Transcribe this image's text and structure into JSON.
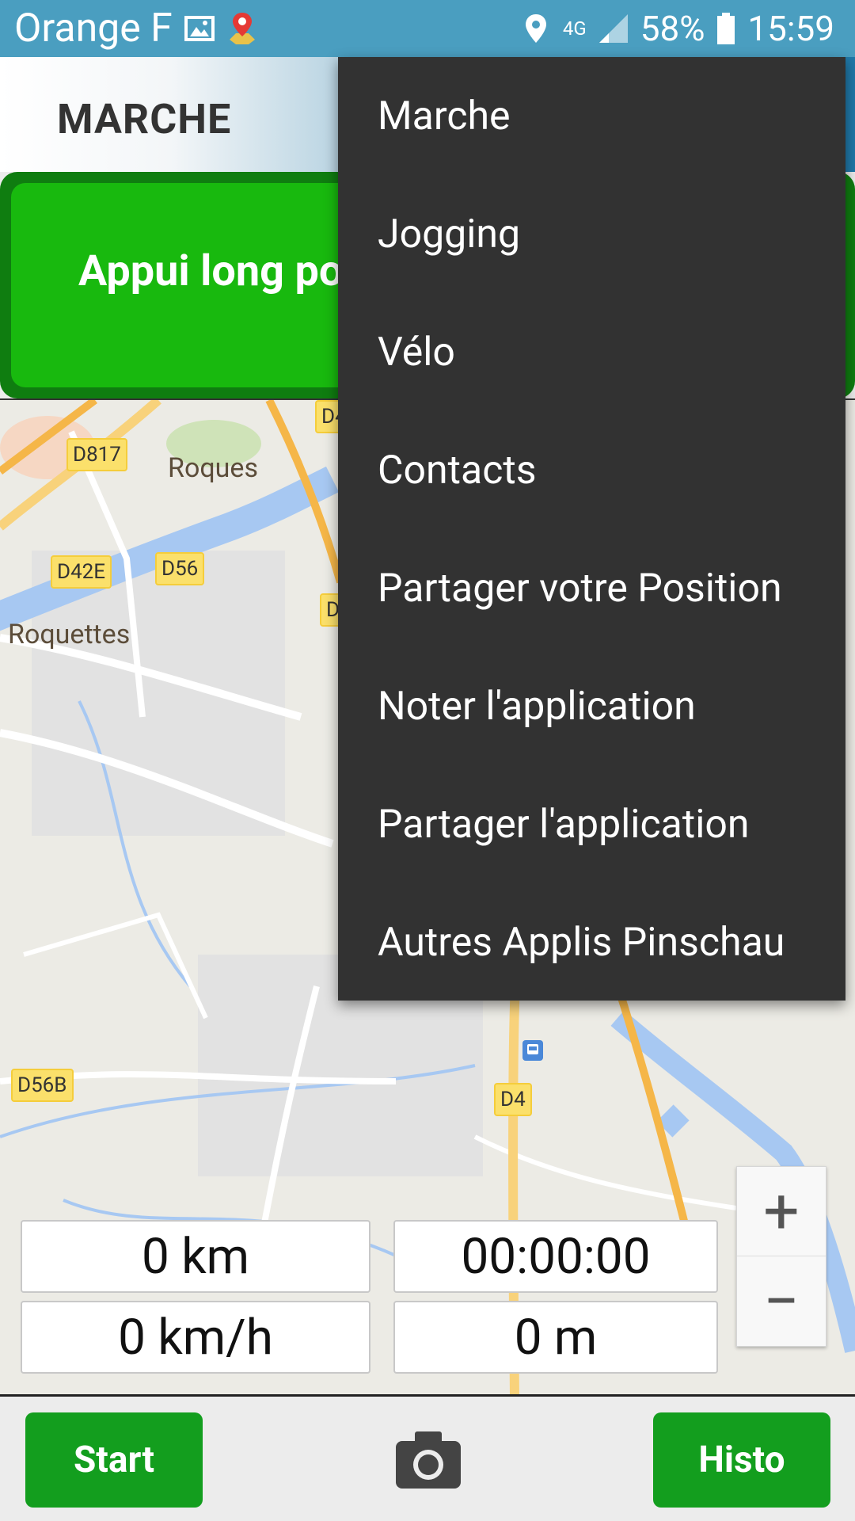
{
  "status_bar": {
    "carrier": "Orange F",
    "battery": "58%",
    "time": "15:59",
    "network": "4G",
    "icons": [
      "image-icon",
      "map-pin-app-icon",
      "location-icon",
      "signal-icon",
      "battery-icon"
    ]
  },
  "action_bar": {
    "title": "MARCHE"
  },
  "banner": {
    "text": "Appui long po"
  },
  "map": {
    "road_labels": [
      "D817",
      "D42E",
      "D56",
      "D4",
      "D",
      "D56B",
      "D4"
    ],
    "places": [
      "Roques",
      "Roquettes"
    ],
    "zoom_in": "+",
    "zoom_out": "−"
  },
  "stats": {
    "distance": "0 km",
    "duration": "00:00:00",
    "speed": "0 km/h",
    "altitude": "0 m"
  },
  "bottom": {
    "start_label": "Start",
    "histo_label": "Histo"
  },
  "menu": {
    "items": [
      "Marche",
      "Jogging",
      "Vélo",
      "Contacts",
      "Partager votre Position",
      "Noter l'application",
      "Partager l'application",
      "Autres Applis Pinschau"
    ]
  },
  "colors": {
    "status_bar": "#4a9ec0",
    "banner_green": "#18b90e",
    "button_green": "#139e1e",
    "menu_bg": "#323232"
  }
}
